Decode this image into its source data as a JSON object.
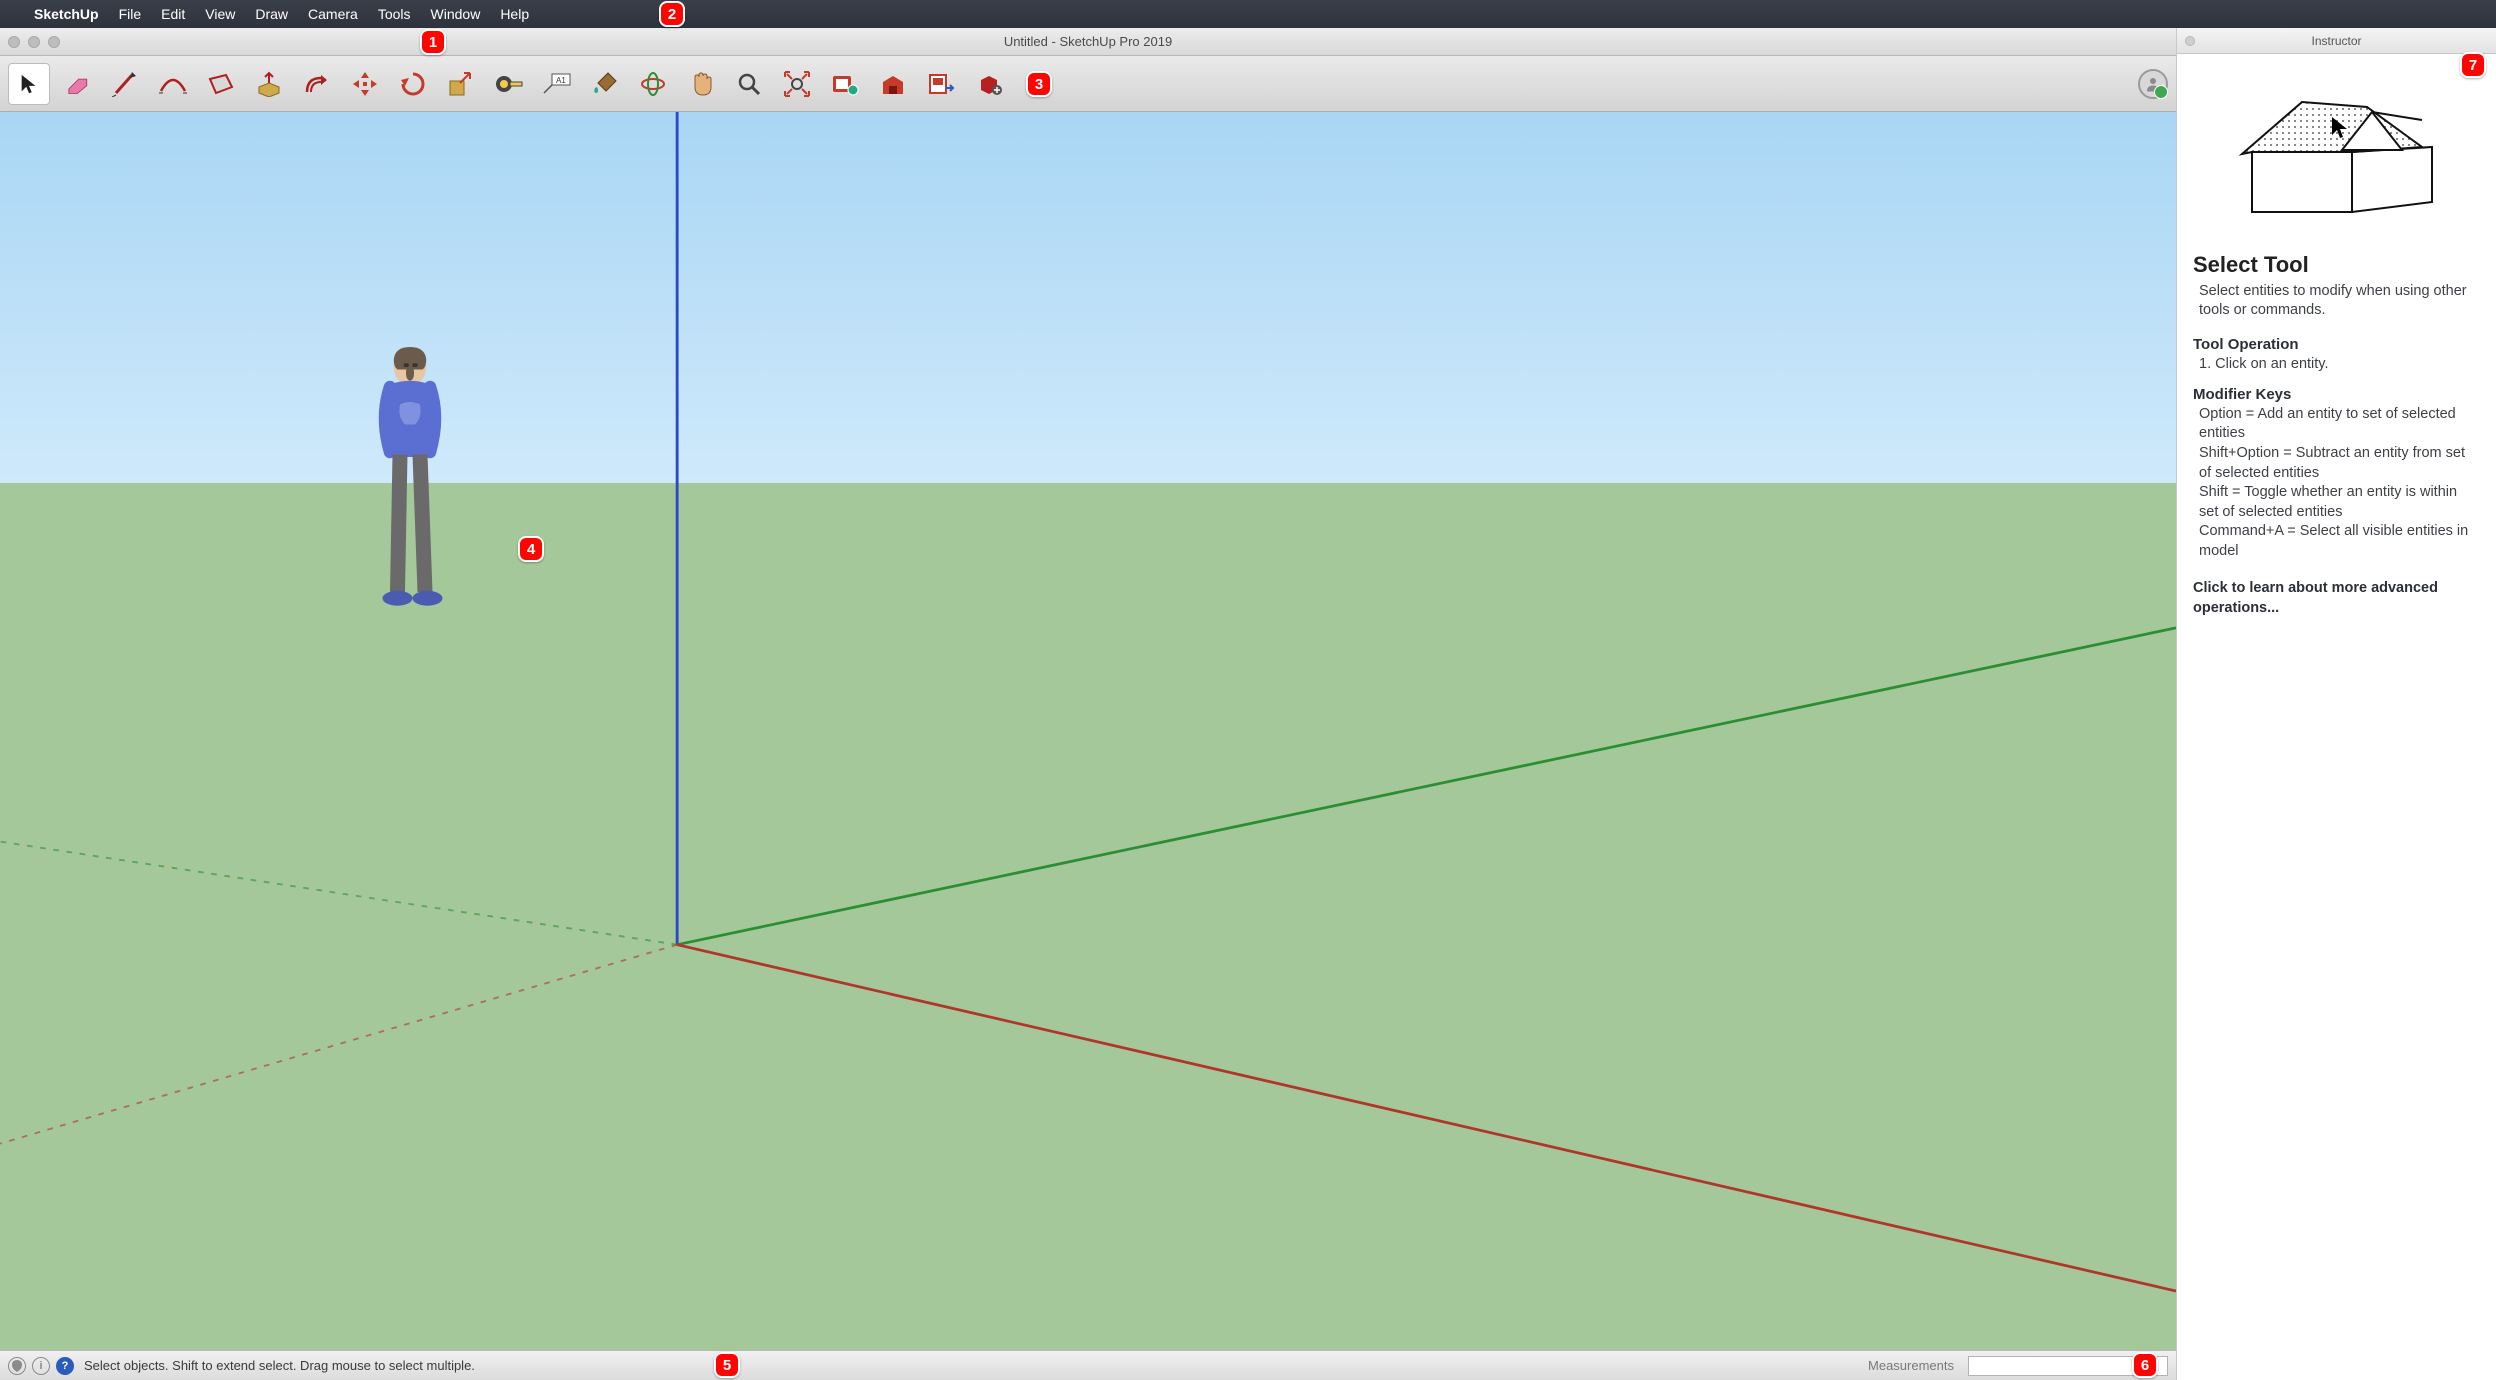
{
  "menubar": {
    "app_name": "SketchUp",
    "items": [
      "File",
      "Edit",
      "View",
      "Draw",
      "Camera",
      "Tools",
      "Window",
      "Help"
    ]
  },
  "window": {
    "title": "Untitled - SketchUp Pro 2019"
  },
  "toolbar": {
    "tools": [
      "select",
      "eraser",
      "line",
      "arc",
      "rectangle",
      "push-pull",
      "offset",
      "move",
      "rotate",
      "scale",
      "tape-measure",
      "text",
      "paint-bucket",
      "orbit",
      "pan",
      "zoom",
      "zoom-extents",
      "add-location",
      "3d-warehouse",
      "layout",
      "extension-warehouse"
    ]
  },
  "statusbar": {
    "message": "Select objects. Shift to extend select. Drag mouse to select multiple.",
    "measurements_label": "Measurements",
    "measurements_value": ""
  },
  "instructor": {
    "panel_title": "Instructor",
    "tool_title": "Select Tool",
    "tool_subtitle": "Select entities to modify when using other tools or commands.",
    "operation_title": "Tool Operation",
    "operation_body": "1. Click on an entity.",
    "modifiers_title": "Modifier Keys",
    "modifiers_body": "Option = Add an entity to set of selected entities\nShift+Option = Subtract an entity from set of selected entities\nShift = Toggle whether an entity is within set of selected entities\nCommand+A = Select all visible entities in model",
    "learn_more": "Click to learn about more advanced operations..."
  },
  "callouts": {
    "c1": "1",
    "c2": "2",
    "c3": "3",
    "c4": "4",
    "c5": "5",
    "c6": "6",
    "c7": "7"
  },
  "colors": {
    "axis_red": "#b0362a",
    "axis_green": "#2c8e33",
    "axis_blue": "#2a49c8"
  }
}
